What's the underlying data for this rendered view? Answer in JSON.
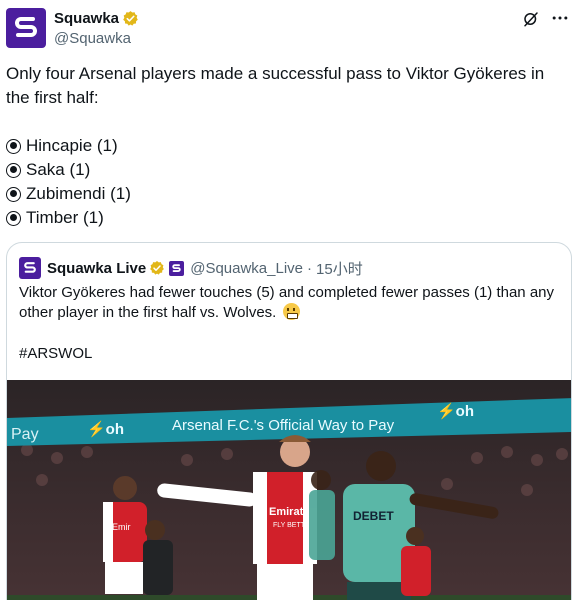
{
  "author": {
    "display_name": "Squawka",
    "handle": "@Squawka"
  },
  "tweet": {
    "text": "Only four Arsenal players made a successful pass to Viktor Gyökeres in the first half:",
    "bullets": [
      "Hincapie (1)",
      "Saka (1)",
      "Zubimendi (1)",
      "Timber (1)"
    ]
  },
  "quoted": {
    "display_name": "Squawka Live",
    "handle": "@Squawka_Live",
    "separator": "·",
    "time": "15小时",
    "text": "Viktor Gyökeres had fewer touches (5) and completed fewer passes (1) than any other player in the first half vs. Wolves.",
    "hashtag": "#ARSWOL"
  },
  "photo": {
    "banner_text": "Arsenal F.C.'s Official Way to Pay",
    "banner_left": "Pay",
    "banner_logo": "⚡oh",
    "jersey_sponsor_red": "Emirates",
    "jersey_sponsor_red_sub": "FLY BETTER",
    "jersey_sponsor_teal": "DEBET"
  },
  "colors": {
    "brand_purple": "#4b1e9e",
    "verified_gold": "#e2b719",
    "text_primary": "#0f1419",
    "text_secondary": "#536471",
    "border": "#cfd9de"
  },
  "icons": {
    "grok": "grok-icon",
    "more": "more-icon",
    "verified": "verified-badge-icon"
  }
}
